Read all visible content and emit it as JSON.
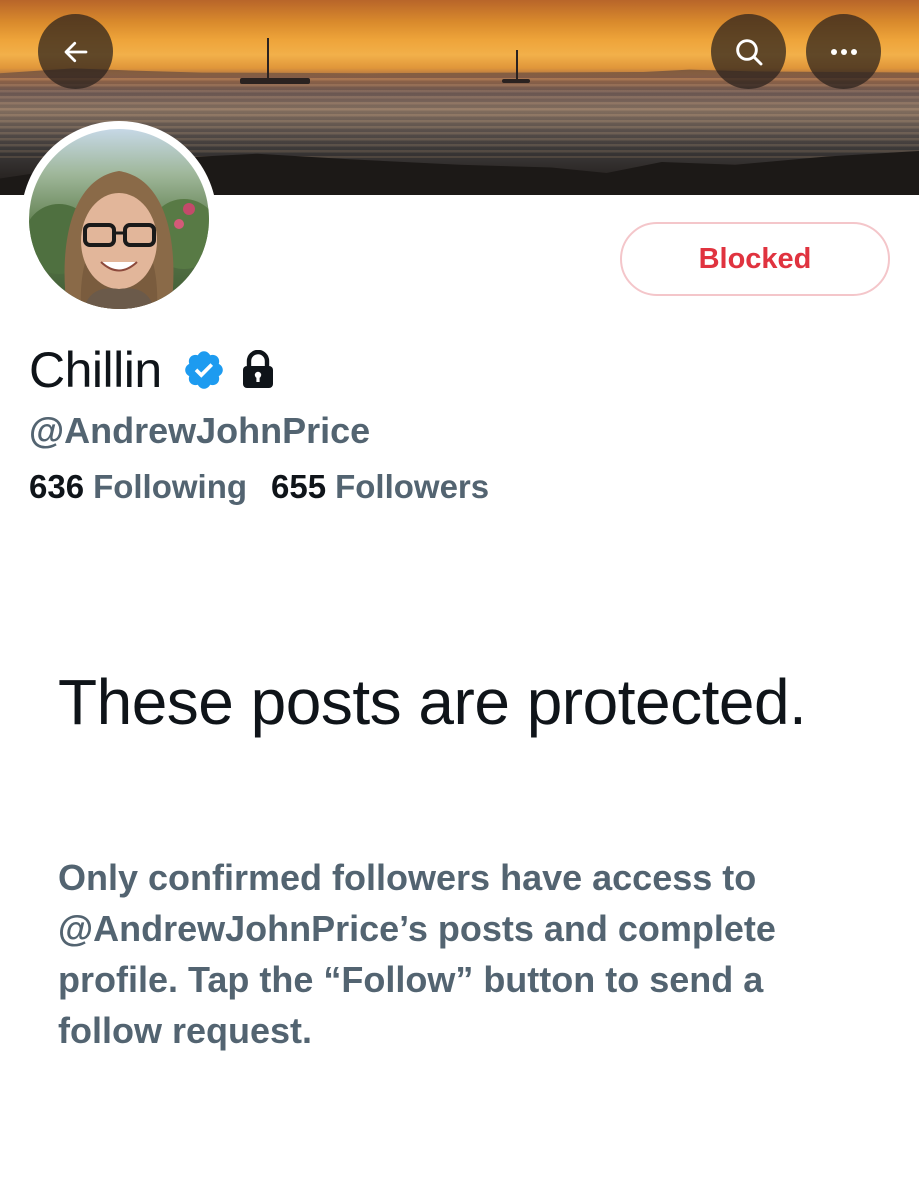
{
  "header": {
    "back_icon": "arrow-left-icon",
    "search_icon": "search-icon",
    "more_icon": "more-horizontal-icon"
  },
  "profile": {
    "display_name": "Chillin",
    "verified_icon": "verified-badge-icon",
    "protected_icon": "lock-icon",
    "handle": "@AndrewJohnPrice",
    "following_count": "636",
    "following_label": "Following",
    "followers_count": "655",
    "followers_label": "Followers",
    "action_button_label": "Blocked"
  },
  "protected_notice": {
    "title": "These posts are protected.",
    "body": "Only confirmed followers have access to @AndrewJohnPrice’s posts and complete profile. Tap the “Follow” button to send a follow request."
  },
  "colors": {
    "text_primary": "#0f1419",
    "text_secondary": "#536471",
    "blocked_red": "#e0333f",
    "blocked_border": "#f4c6ca",
    "verified_blue": "#1d9bf0"
  }
}
